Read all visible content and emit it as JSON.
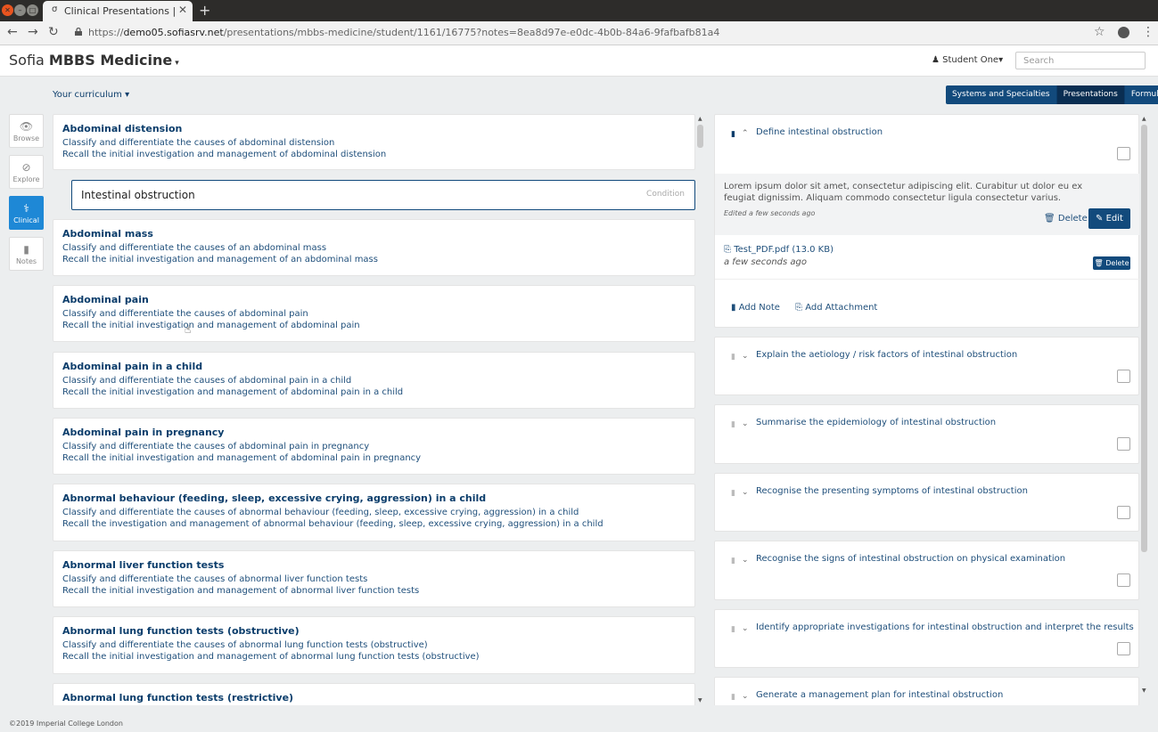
{
  "browser": {
    "tab_title": "Clinical Presentations | Cu",
    "tab_favicon": "σ",
    "new_tab": "+",
    "url_prefix": "https://",
    "url_host": "demo05.sofiasrv.net",
    "url_path": "/presentations/mbbs-medicine/student/1161/16775?notes=8ea8d97e-e0dc-4b0b-84a6-9fafbafb81a4"
  },
  "header": {
    "brand_light": "Sofia",
    "brand_bold": "MBBS Medicine",
    "user": "Student One",
    "search_placeholder": "Search"
  },
  "curriculum_label": "Your curriculum",
  "view_toggle": [
    "Systems and Specialties",
    "Presentations",
    "Formulary"
  ],
  "sidenav": [
    {
      "label": "Browse",
      "icon": "eye-icon"
    },
    {
      "label": "Explore",
      "icon": "compass-icon"
    },
    {
      "label": "Clinical",
      "icon": "doctor-icon"
    },
    {
      "label": "Notes",
      "icon": "bookmark-icon"
    }
  ],
  "presentations": [
    {
      "title": "Abdominal distension",
      "lines": [
        "Classify and differentiate the causes of abdominal distension",
        "Recall the initial investigation and management of abdominal distension"
      ]
    },
    {
      "title": "Abdominal mass",
      "lines": [
        "Classify and differentiate the causes of an abdominal mass",
        "Recall the initial investigation and management of an abdominal mass"
      ]
    },
    {
      "title": "Abdominal pain",
      "lines": [
        "Classify and differentiate the causes of abdominal pain",
        "Recall the initial investigation and management of abdominal pain"
      ]
    },
    {
      "title": "Abdominal pain in a child",
      "lines": [
        "Classify and differentiate the causes of abdominal pain in a child",
        "Recall the initial investigation and management of abdominal pain in a child"
      ]
    },
    {
      "title": "Abdominal pain in pregnancy",
      "lines": [
        "Classify and differentiate the causes of abdominal pain in pregnancy",
        "Recall the initial investigation and management of abdominal pain in pregnancy"
      ]
    },
    {
      "title": "Abnormal behaviour (feeding, sleep, excessive crying, aggression) in a child",
      "lines": [
        "Classify and differentiate the causes of abnormal behaviour (feeding, sleep, excessive crying, aggression) in a child",
        "Recall the investigation and management of abnormal behaviour (feeding, sleep, excessive crying, aggression) in a child"
      ]
    },
    {
      "title": "Abnormal liver function tests",
      "lines": [
        "Classify and differentiate the causes of abnormal liver function tests",
        "Recall the initial investigation and management of abnormal liver function tests"
      ]
    },
    {
      "title": "Abnormal lung function tests (obstructive)",
      "lines": [
        "Classify and differentiate the causes of abnormal lung function tests (obstructive)",
        "Recall the initial investigation and management of abnormal lung function tests (obstructive)"
      ]
    },
    {
      "title": "Abnormal lung function tests (restrictive)",
      "lines": []
    }
  ],
  "selected_condition": {
    "name": "Intestinal obstruction",
    "badge": "Condition"
  },
  "objectives": [
    "Define intestinal obstruction",
    "Explain the aetiology / risk factors of intestinal obstruction",
    "Summarise the epidemiology of intestinal obstruction",
    "Recognise the presenting symptoms of intestinal obstruction",
    "Recognise the signs of intestinal obstruction on physical examination",
    "Identify appropriate investigations for intestinal obstruction and interpret the results",
    "Generate a management plan for intestinal obstruction"
  ],
  "note": {
    "text": "Lorem ipsum dolor sit amet, consectetur adipiscing elit. Curabitur ut dolor eu ex feugiat dignissim. Aliquam commodo consectetur ligula consectetur varius.",
    "edited": "Edited a few seconds ago",
    "delete_label": "Delete",
    "edit_label": "Edit"
  },
  "attachment": {
    "name": "Test_PDF.pdf (13.0 KB)",
    "time": "a few seconds ago",
    "delete_label": "Delete"
  },
  "actions": {
    "add_note": "Add Note",
    "add_attachment": "Add Attachment"
  },
  "footer": "©2019 Imperial College London"
}
